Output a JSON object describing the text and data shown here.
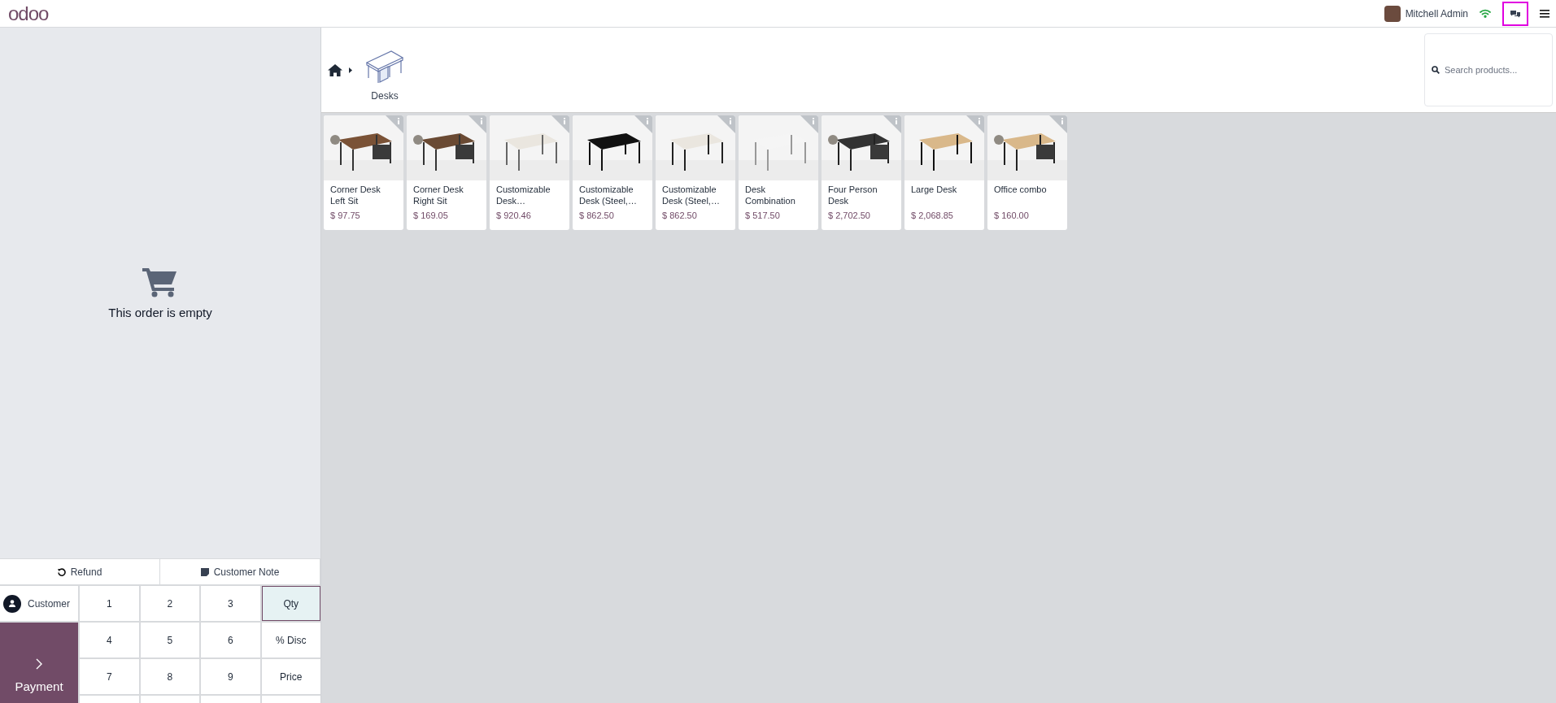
{
  "topbar": {
    "logo": "odoo",
    "user": {
      "name": "Mitchell Admin"
    },
    "chat_button": {
      "highlighted": true
    }
  },
  "order": {
    "empty_message": "This order is empty"
  },
  "actions": [
    "Refund",
    "Customer Note"
  ],
  "customer_button": "Customer",
  "payment_button": "Payment",
  "numpad": [
    {
      "label": "1",
      "selected": false
    },
    {
      "label": "2",
      "selected": false
    },
    {
      "label": "3",
      "selected": false
    },
    {
      "label": "Qty",
      "selected": true
    },
    {
      "label": "4",
      "selected": false
    },
    {
      "label": "5",
      "selected": false
    },
    {
      "label": "6",
      "selected": false
    },
    {
      "label": "% Disc",
      "selected": false
    },
    {
      "label": "7",
      "selected": false
    },
    {
      "label": "8",
      "selected": false
    },
    {
      "label": "9",
      "selected": false
    },
    {
      "label": "Price",
      "selected": false
    }
  ],
  "categories": [
    {
      "label": "Desks"
    }
  ],
  "search": {
    "placeholder": "Search products..."
  },
  "products": [
    {
      "name": "Corner Desk Left Sit",
      "price": "$ 97.75"
    },
    {
      "name": "Corner Desk Right Sit",
      "price": "$ 169.05"
    },
    {
      "name": "Customizable Desk…",
      "price": "$ 920.46"
    },
    {
      "name": "Customizable Desk (Steel,…",
      "price": "$ 862.50"
    },
    {
      "name": "Customizable Desk (Steel,…",
      "price": "$ 862.50"
    },
    {
      "name": "Desk Combination",
      "price": "$ 517.50"
    },
    {
      "name": "Four Person Desk",
      "price": "$ 2,702.50"
    },
    {
      "name": "Large Desk",
      "price": "$ 2,068.85"
    },
    {
      "name": "Office combo",
      "price": "$ 160.00"
    }
  ]
}
